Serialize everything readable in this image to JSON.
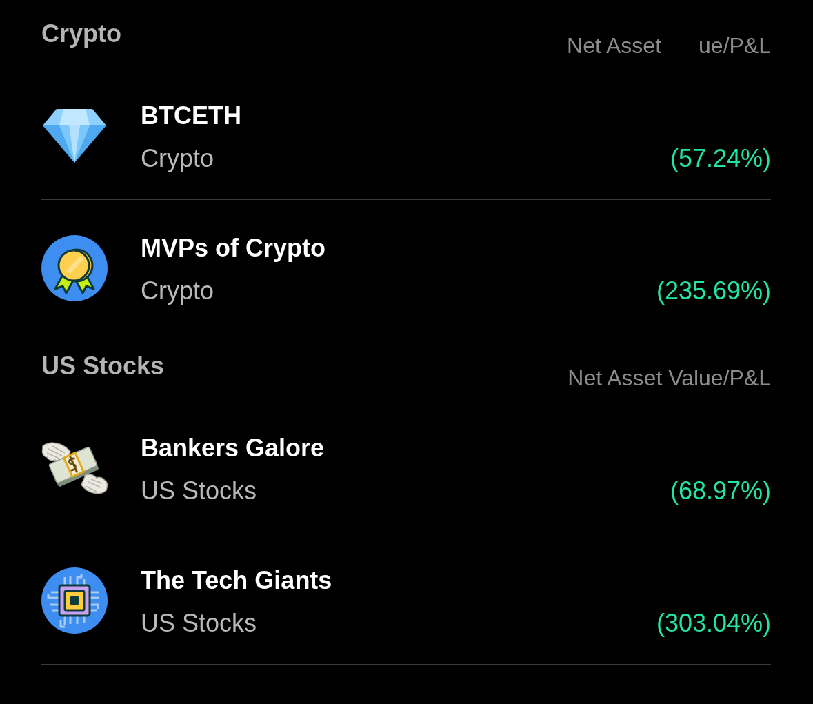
{
  "sections": [
    {
      "title": "Crypto",
      "column_header": [
        "Net Asset",
        "ue/P&L"
      ],
      "rows": [
        {
          "name": "BTCETH",
          "category": "Crypto",
          "pnl": "(57.24%)"
        },
        {
          "name": "MVPs of Crypto",
          "category": "Crypto",
          "pnl": "(235.69%)"
        }
      ]
    },
    {
      "title": "US Stocks",
      "column_header": [
        "Net Asset Value/P&L"
      ],
      "rows": [
        {
          "name": "Bankers Galore",
          "category": "US Stocks",
          "pnl": "(68.97%)"
        },
        {
          "name": "The Tech Giants",
          "category": "US Stocks",
          "pnl": "(303.04%)"
        }
      ]
    }
  ]
}
